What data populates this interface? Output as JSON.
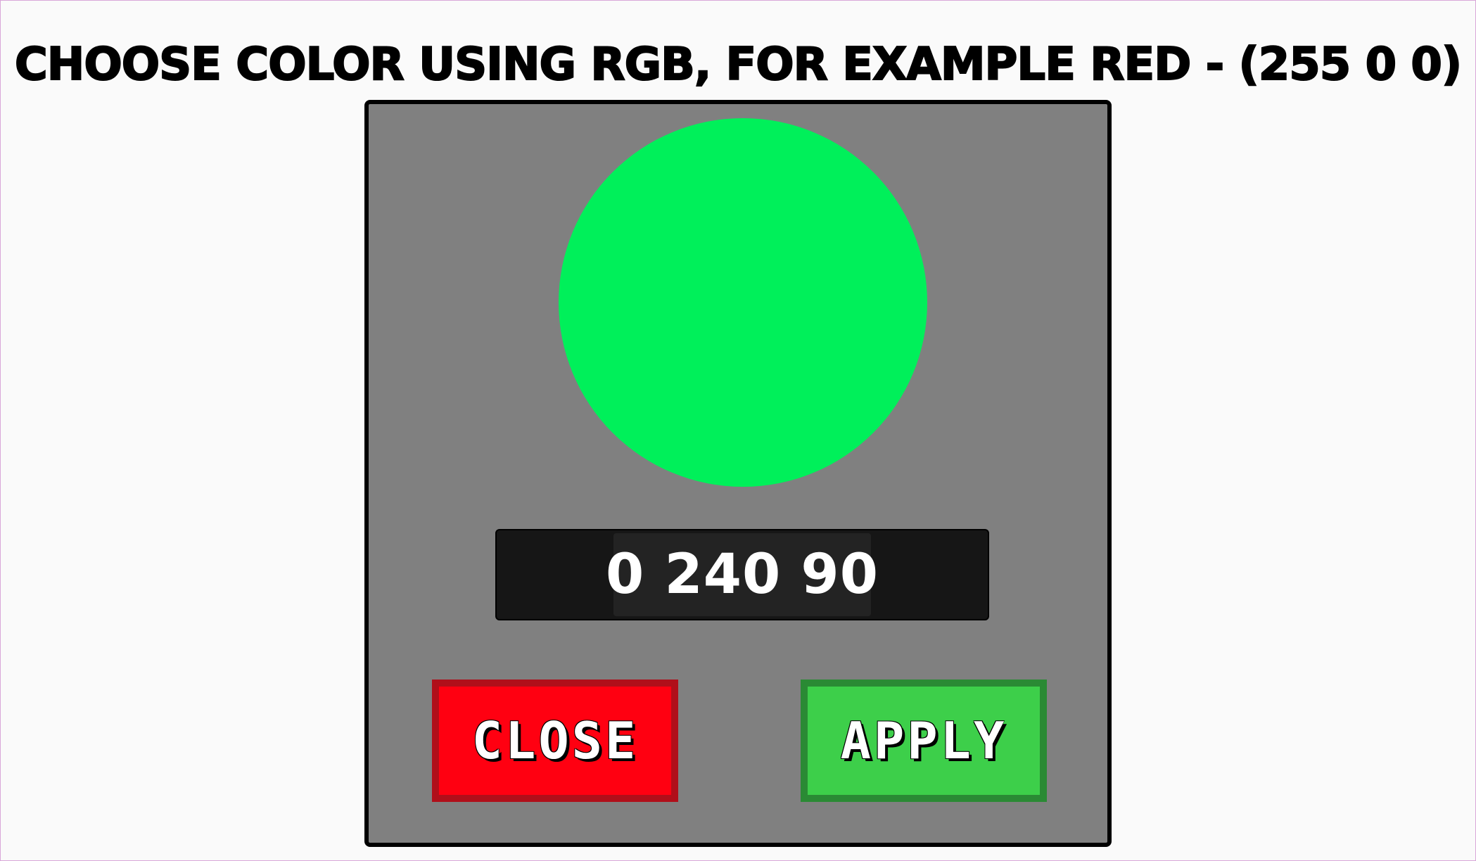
{
  "title": "CHOOSE COLOR USING RGB, FOR EXAMPLE RED - (255 0 0)",
  "picker": {
    "preview_color": "#00f05a",
    "rgb_value": "0 240 90"
  },
  "buttons": {
    "close_label": "CLOSE",
    "apply_label": "APPLY"
  },
  "colors": {
    "page_background": "#fafafa",
    "dialog_background": "#808080",
    "close_button": "#ff0011",
    "apply_button": "#3dcf4a"
  }
}
